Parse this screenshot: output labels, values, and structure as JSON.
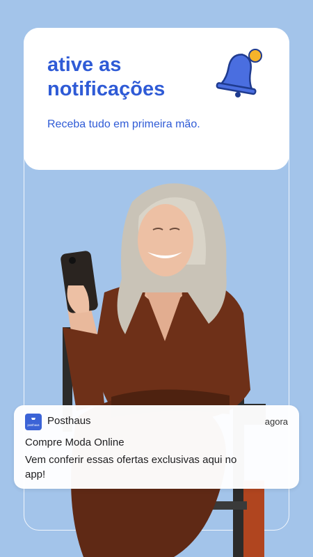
{
  "header": {
    "title": "ative as notificações",
    "subtitle": "Receba tudo em primeira mão."
  },
  "notification": {
    "app_name": "Posthaus",
    "app_icon_text": "posthaus",
    "time": "agora",
    "title": "Compre Moda Online",
    "body": "Vem conferir essas ofertas exclusivas aqui no app!"
  },
  "colors": {
    "background": "#a3c4ea",
    "accent": "#2f5bd6",
    "bell": "#4a6ee0",
    "bell_dot": "#f5b32a",
    "dress": "#6e3018"
  },
  "icons": [
    "bell-icon",
    "posthaus-app-icon"
  ]
}
